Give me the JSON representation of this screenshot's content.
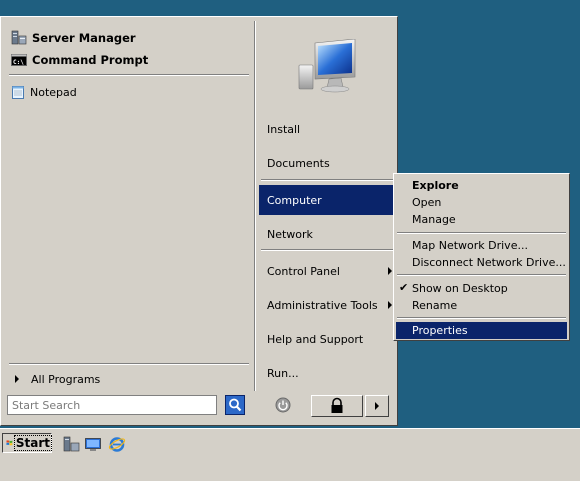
{
  "start_menu": {
    "pinned": [
      "Server Manager",
      "Command Prompt"
    ],
    "recent": [
      "Notepad"
    ],
    "all_programs_label": "All Programs",
    "right_items": [
      {
        "label": "Install"
      },
      {
        "label": "Documents"
      },
      {
        "label": "Computer",
        "selected": true
      },
      {
        "label": "Network"
      },
      {
        "label": "Control Panel",
        "submenu": true
      },
      {
        "label": "Administrative Tools",
        "submenu": true
      },
      {
        "label": "Help and Support"
      },
      {
        "label": "Run..."
      }
    ],
    "search_placeholder": "Start Search"
  },
  "context_menu": {
    "items": [
      {
        "label": "Explore",
        "bold": true
      },
      {
        "label": "Open"
      },
      {
        "label": "Manage"
      },
      {
        "label": "Map Network Drive..."
      },
      {
        "label": "Disconnect Network Drive..."
      },
      {
        "label": "Show on Desktop",
        "checked": true
      },
      {
        "label": "Rename"
      },
      {
        "label": "Properties",
        "selected": true
      }
    ]
  },
  "taskbar": {
    "start_label": "Start",
    "quick_launch": [
      "server-manager-icon",
      "show-desktop-icon",
      "internet-explorer-icon"
    ]
  },
  "colors": {
    "desktop": "#1f5f80",
    "menu_face": "#d4d0c8",
    "selection": "#0a246a"
  }
}
